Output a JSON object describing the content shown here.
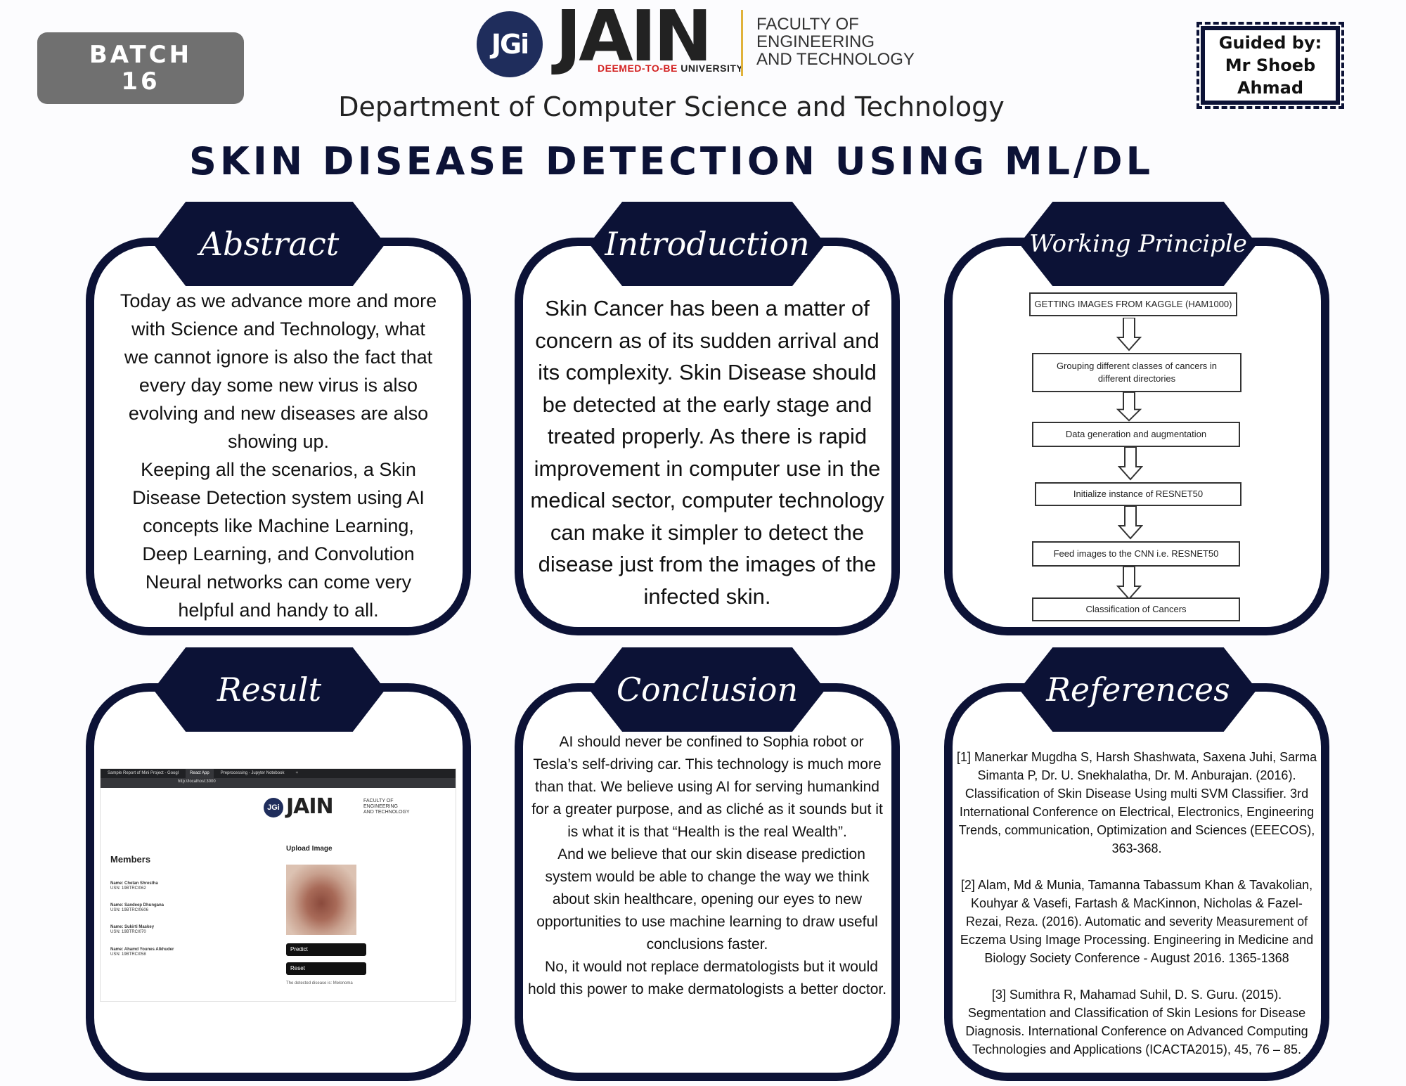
{
  "header": {
    "batch_line1": "BATCH",
    "batch_line2": "16",
    "logo_mark": "JGi",
    "logo_name": "JAIN",
    "logo_sub_prefix": "DEEMED-TO-BE",
    "logo_sub_suffix": "UNIVERSITY",
    "faculty": "FACULTY OF\nENGINEERING\nAND TECHNOLOGY",
    "guided_label": "Guided by:",
    "guided_name": "Mr Shoeb Ahmad",
    "department": "Department of Computer Science and Technology",
    "title": "SKIN DISEASE DETECTION USING ML/DL"
  },
  "abstract": {
    "heading": "Abstract",
    "para1": "Today as we advance more and more with Science and Technology, what we cannot ignore is also the fact that every day some new virus is also evolving and new diseases are also showing up.",
    "para2": "Keeping all the scenarios, a Skin Disease Detection system using AI concepts like Machine Learning, Deep Learning, and Convolution Neural networks can come very helpful and handy to all."
  },
  "introduction": {
    "heading": "Introduction",
    "text": "Skin Cancer has been a matter of concern as of its sudden arrival and its complexity. Skin Disease should be detected at the early stage and treated properly. As there is rapid improvement in computer use in the medical sector, computer technology can make it simpler to detect the disease just from the images of the infected skin."
  },
  "working_principle": {
    "heading": "Working Principle",
    "steps": [
      "GETTING IMAGES FROM KAGGLE (HAM1000)",
      "Grouping different classes of cancers in different directories",
      "Data generation and augmentation",
      "Initialize instance of RESNET50",
      "Feed images to the CNN i.e. RESNET50",
      "Classification of Cancers"
    ]
  },
  "result": {
    "heading": "Result",
    "tabs": [
      "Sample Report of Mini Project - Googl",
      "React App",
      "Preprocessing - Jupyter Notebook",
      "+"
    ],
    "url": "http://localhost:3000",
    "app_logo_mark": "JGi",
    "app_logo_name": "JAIN",
    "app_faculty": "FACULTY OF\nENGINEERING\nAND TECHNOLOGY",
    "members_title": "Members",
    "members": [
      {
        "name": "Name: Chetan Shrestha",
        "usn": "USN: 19BTRCI062"
      },
      {
        "name": "Name: Sandeep Dhungana",
        "usn": "USN: 19BTRCI0606"
      },
      {
        "name": "Name: Sukirti Maskey",
        "usn": "USN: 19BTRCI070"
      },
      {
        "name": "Name: Ahamd Younes Alkhuder",
        "usn": "USN: 19BTRCI058"
      }
    ],
    "upload_label": "Upload Image",
    "predict_button": "Predict",
    "reset_button": "Reset",
    "detected_text": "The detected disease is: Melonoma"
  },
  "conclusion": {
    "heading": "Conclusion",
    "para1": "AI should never be confined to Sophia robot or Tesla’s self-driving car. This technology is much more than that. We believe using AI for serving humankind for a greater purpose, and as cliché as it sounds but it is what it is that “Health is the real Wealth”.",
    "para2": "And we believe that our skin disease prediction system would be able to change the way we think about skin healthcare, opening our eyes to new opportunities to use machine learning to draw useful conclusions faster.",
    "para3": "No, it would not replace dermatologists but it would hold this power to make dermatologists a better doctor."
  },
  "references": {
    "heading": "References",
    "items": [
      "[1] Manerkar Mugdha S, Harsh Shashwata, Saxena Juhi, Sarma Simanta P, Dr. U. Snekhalatha, Dr. M. Anburajan. (2016). Classification of Skin Disease Using multi SVM Classifier. 3rd International Conference on Electrical, Electronics, Engineering Trends, communication, Optimization and Sciences (EEECOS), 363-368.",
      "[2] Alam, Md & Munia, Tamanna Tabassum Khan & Tavakolian, Kouhyar & Vasefi, Fartash & MacKinnon, Nicholas & Fazel-Rezai, Reza. (2016). Automatic and severity Measurement of Eczema Using Image Processing. Engineering in Medicine and Biology Society Conference - August 2016. 1365-1368",
      "[3] Sumithra R, Mahamad Suhil, D. S. Guru. (2015). Segmentation and Classification of Skin Lesions for Disease Diagnosis. International Conference on Advanced Computing Technologies and Applications (ICACTA2015), 45, 76 – 85."
    ]
  }
}
